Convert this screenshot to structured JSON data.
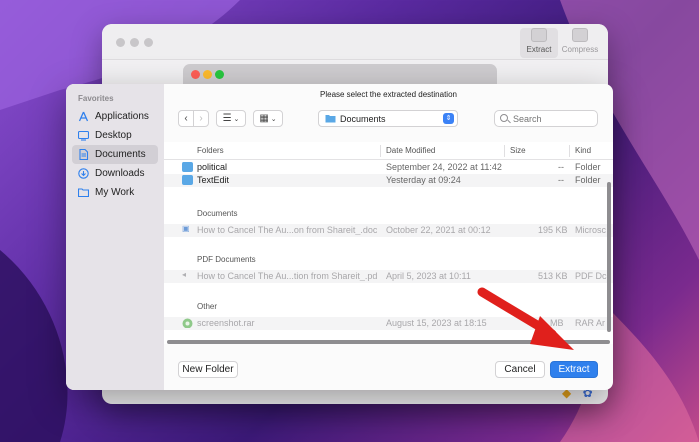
{
  "app": {
    "toolbar": [
      {
        "label": "Extract",
        "icon": "extract-icon"
      },
      {
        "label": "Compress",
        "icon": "compress-icon"
      }
    ]
  },
  "dialog": {
    "prompt": "Please select the extracted destination",
    "sidebar": {
      "heading": "Favorites",
      "items": [
        {
          "label": "Applications",
          "icon": "applications-icon",
          "selected": false
        },
        {
          "label": "Desktop",
          "icon": "desktop-icon",
          "selected": false
        },
        {
          "label": "Documents",
          "icon": "document-icon",
          "selected": true
        },
        {
          "label": "Downloads",
          "icon": "download-icon",
          "selected": false
        },
        {
          "label": "My Work",
          "icon": "folder-icon",
          "selected": false
        }
      ]
    },
    "toolbar": {
      "back": "‹",
      "forward": "›",
      "location": "Documents",
      "search_placeholder": "Search"
    },
    "columns": [
      "Folders",
      "Date Modified",
      "Size",
      "Kind"
    ],
    "folders": [
      {
        "name": "political",
        "date": "September 24, 2022 at 11:42",
        "size": "--",
        "kind": "Folder"
      },
      {
        "name": "TextEdit",
        "date": "Yesterday at 09:24",
        "size": "--",
        "kind": "Folder"
      }
    ],
    "sections": [
      {
        "title": "Documents",
        "files": [
          {
            "name": "How to Cancel The Au...on from Shareit_.docx",
            "date": "October 22, 2021 at 00:12",
            "size": "195 KB",
            "kind": "Microsc"
          }
        ]
      },
      {
        "title": "PDF Documents",
        "files": [
          {
            "name": "How to Cancel The Au...tion from Shareit_.pdf",
            "date": "April 5, 2023 at 10:11",
            "size": "513 KB",
            "kind": "PDF Dc"
          }
        ]
      },
      {
        "title": "Other",
        "files": [
          {
            "name": "screenshot.rar",
            "date": "August 15, 2023 at 18:15",
            "size": "MB",
            "kind": "RAR Ar"
          }
        ]
      }
    ],
    "footer": {
      "new_folder": "New Folder",
      "cancel": "Cancel",
      "extract": "Extract"
    }
  },
  "colors": {
    "accent": "#2f80ed",
    "folder": "#5aa8e6",
    "annotation_arrow": "#e0201c"
  }
}
